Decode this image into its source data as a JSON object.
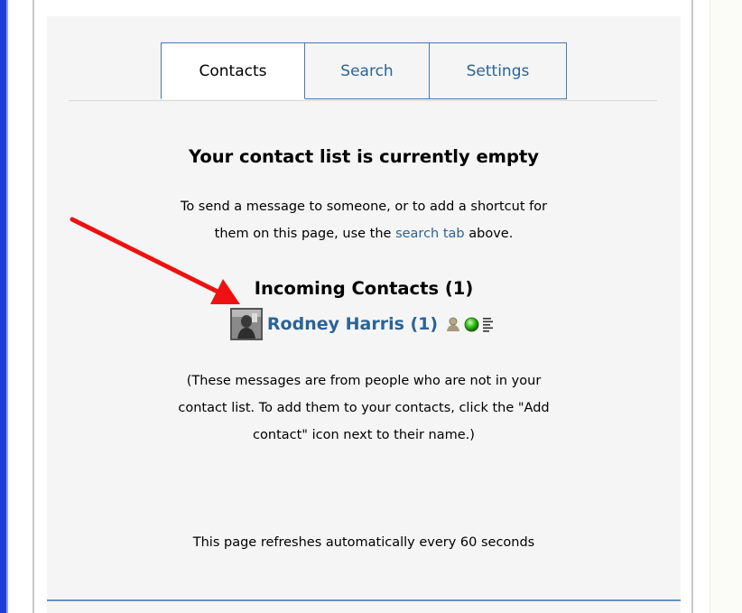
{
  "tabs": {
    "contacts": "Contacts",
    "search": "Search",
    "settings": "Settings"
  },
  "main": {
    "title": "Your contact list is currently empty",
    "intro_line1": "To send a message to someone, or to add a shortcut for",
    "intro_line2_before": "them on this page, use the",
    "intro_link": "search tab",
    "intro_line2_after": "above.",
    "incoming_title": "Incoming Contacts (1)",
    "contact_name": "Rodney Harris (1)",
    "note_line1": "(These messages are from people who are not in your",
    "note_line2": "contact list. To add them to your contacts, click the \"Add",
    "note_line3": "contact\" icon next to their name.)",
    "refresh": "This page refreshes automatically every 60 seconds"
  },
  "icons": {
    "add_contact": "add-contact-icon",
    "online_status": "online-status-icon",
    "message_log": "message-log-icon",
    "annotation_arrow": "red-arrow-annotation"
  },
  "colors": {
    "link": "#2a6496",
    "tab_border": "#4b78b0",
    "panel_bg": "#f5f5f5",
    "arrow": "#ee1111",
    "left_bar": "#1e3fd6"
  }
}
